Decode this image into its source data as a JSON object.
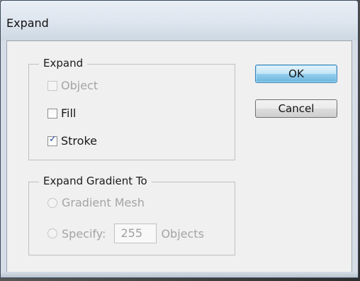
{
  "window": {
    "title": "Expand"
  },
  "expand_group": {
    "legend": "Expand",
    "object_label": "Object",
    "fill_label": "Fill",
    "stroke_label": "Stroke"
  },
  "gradient_group": {
    "legend": "Expand Gradient To",
    "gradient_mesh_label": "Gradient Mesh",
    "specify_label": "Specify:",
    "specify_value": "255",
    "objects_label": "Objects"
  },
  "buttons": {
    "ok_label": "OK",
    "cancel_label": "Cancel"
  },
  "state": {
    "object_checked": false,
    "object_enabled": false,
    "fill_checked": false,
    "stroke_checked": true,
    "gradient_mesh_enabled": false,
    "specify_enabled": false
  },
  "colors": {
    "default_button": "#98d1ef",
    "checkmark": "#2b4fa8",
    "disabled_text": "#a4a4a4"
  }
}
